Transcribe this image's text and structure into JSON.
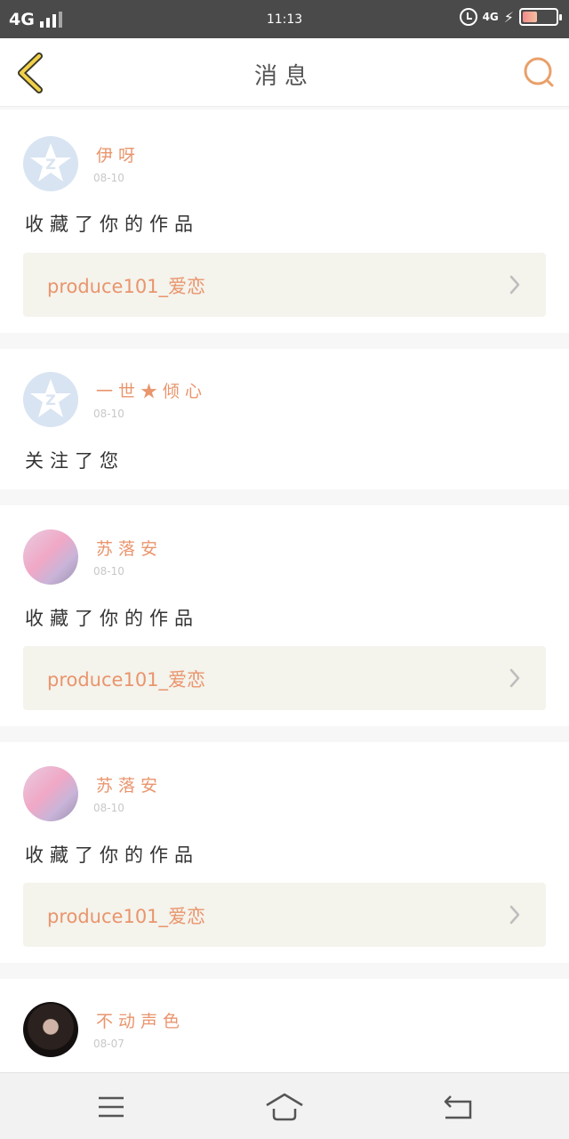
{
  "status_bar": {
    "network": "4G",
    "time": "11:13",
    "network_right": "4G",
    "icons": [
      "signal-icon",
      "alarm-icon",
      "lightning-icon",
      "battery-icon"
    ],
    "battery_level": 0.45
  },
  "header": {
    "title": "消息",
    "back_icon": "chevron-left-icon",
    "search_icon": "search-icon",
    "accent_color": "#e9a06a"
  },
  "messages": [
    {
      "name": "伊呀",
      "date": "08-10",
      "action": "收藏了你的作品",
      "work": "produce101_爱恋",
      "avatar": "qq-default"
    },
    {
      "name": "一世★倾心",
      "date": "08-10",
      "action": "关注了您",
      "avatar": "qq-default"
    },
    {
      "name": "苏落安",
      "date": "08-10",
      "action": "收藏了你的作品",
      "work": "produce101_爱恋",
      "avatar": "pink-photo"
    },
    {
      "name": "苏落安",
      "date": "08-10",
      "action": "收藏了你的作品",
      "work": "produce101_爱恋",
      "avatar": "pink-photo"
    },
    {
      "name": "不动声色",
      "date": "08-07",
      "avatar": "dark-photo"
    }
  ],
  "nav": {
    "icons": [
      "menu-icon",
      "home-icon",
      "back-icon"
    ]
  },
  "colors": {
    "name": "#e9956d",
    "work_bg": "#f4f3ec"
  }
}
